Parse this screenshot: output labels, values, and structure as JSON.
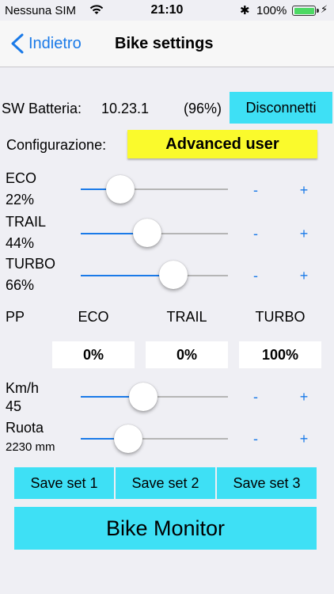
{
  "status_bar": {
    "carrier": "Nessuna SIM",
    "time": "21:10",
    "battery_pct": "100%",
    "icons": [
      "wifi-icon",
      "bluetooth-icon",
      "battery-icon",
      "charging-bolt-icon"
    ]
  },
  "nav": {
    "back_label": "Indietro",
    "title": "Bike settings"
  },
  "battery_row": {
    "label": "SW Batteria:",
    "version": "10.23.1",
    "percent": "(96%)",
    "disconnect_label": "Disconnetti"
  },
  "config": {
    "label": "Configurazione:",
    "value": "Advanced user"
  },
  "assist_levels": [
    {
      "name": "ECO",
      "value": "22%",
      "level": 0.22
    },
    {
      "name": "TRAIL",
      "value": "44%",
      "level": 0.44
    },
    {
      "name": "TURBO",
      "value": "66%",
      "level": 0.66
    }
  ],
  "stepper": {
    "minus": "-",
    "plus": "+"
  },
  "pp": {
    "label": "PP",
    "columns": [
      "ECO",
      "TRAIL",
      "TURBO"
    ],
    "values": [
      "0%",
      "0%",
      "100%"
    ]
  },
  "speed": {
    "label": "Km/h",
    "value": "45"
  },
  "wheel": {
    "label": "Ruota",
    "value": "2230 mm"
  },
  "save_buttons": [
    "Save set 1",
    "Save set 2",
    "Save set 3"
  ],
  "monitor_label": "Bike Monitor",
  "colors": {
    "accent": "#1a7ae8",
    "button": "#3ee0f5",
    "highlight": "#fafa2c",
    "background": "#efeff4"
  }
}
